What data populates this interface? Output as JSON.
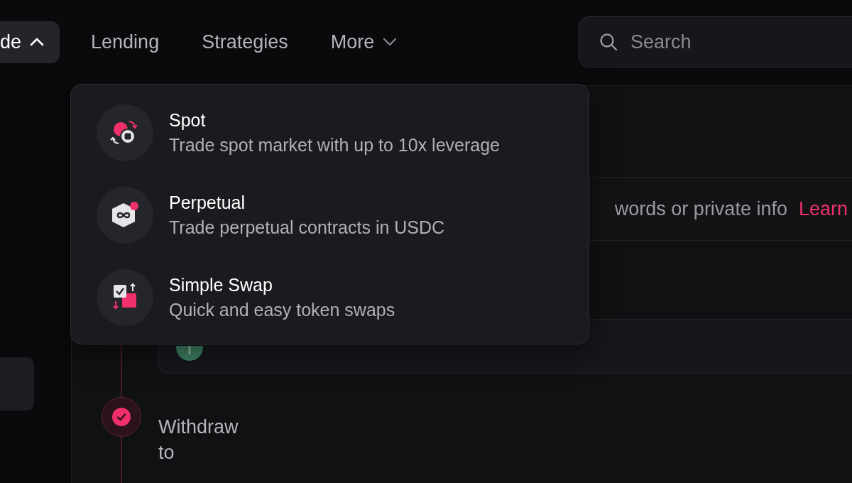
{
  "nav": {
    "items": [
      {
        "label": "de",
        "kind": "dropdown",
        "expanded": true
      },
      {
        "label": "Lending",
        "kind": "link"
      },
      {
        "label": "Strategies",
        "kind": "link"
      },
      {
        "label": "More",
        "kind": "dropdown",
        "expanded": false
      }
    ]
  },
  "search": {
    "placeholder": "Search"
  },
  "menu": {
    "items": [
      {
        "kind": "spot",
        "title": "Spot",
        "description": "Trade spot market with up to 10x leverage"
      },
      {
        "kind": "perpetual",
        "title": "Perpetual",
        "description": "Trade perpetual contracts in USDC"
      },
      {
        "kind": "swap",
        "title": "Simple Swap",
        "description": "Quick and easy token swaps"
      }
    ]
  },
  "notice": {
    "text": "words or private info",
    "link": "Learn"
  },
  "steps": [
    {
      "label": "Withdraw to",
      "done": true
    }
  ]
}
